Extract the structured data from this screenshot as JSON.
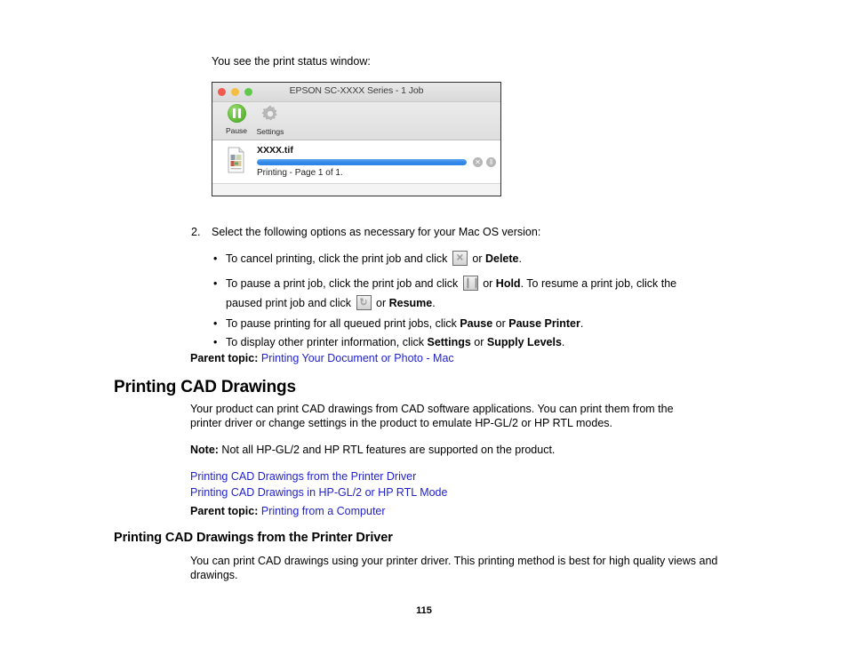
{
  "intro": {
    "text": "You see the print status window:"
  },
  "print_status_window": {
    "title": "EPSON SC-XXXX Series - 1 Job",
    "traffic_lights": {
      "close": "close-button",
      "minimize": "minimize-button",
      "zoom": "zoom-button"
    },
    "toolbar": {
      "pause_label": "Pause",
      "settings_label": "Settings"
    },
    "job": {
      "name": "XXXX.tif",
      "status": "Printing - Page 1 of 1.",
      "progress_percent": 100,
      "cancel_glyph": "✕",
      "hold_glyph": "‖"
    },
    "colors": {
      "close": "#f05a4f",
      "minimize": "#f5bd41",
      "zoom": "#60c94b",
      "pause_badge": "#60c94b",
      "progress": "#2f86e8"
    }
  },
  "step": {
    "number": "2.",
    "text": "Select the following options as necessary for your Mac OS version:",
    "bullet_mark": "•"
  },
  "bullets": {
    "cancel": {
      "part1": "To cancel printing, click the print job and click ",
      "icon": "cancel-x-icon",
      "part2": " or ",
      "bold": "Delete",
      "part3": "."
    },
    "pause": {
      "part1": "To pause a print job, click the print job and click ",
      "icon_hold": "hold-pause-icon",
      "part2": " or ",
      "bold1": "Hold",
      "part3": ". To resume a print job, click the",
      "line2_part1": "paused print job and click ",
      "icon_resume": "resume-icon",
      "line2_part2": " or ",
      "bold2": "Resume",
      "line2_part3": "."
    },
    "pause_all": {
      "part1": "To pause printing for all queued print jobs, click ",
      "bold1": "Pause",
      "part2": " or ",
      "bold2": "Pause Printer",
      "part3": "."
    },
    "display_info": {
      "part1": "To display other printer information, click ",
      "bold1": "Settings",
      "part2": " or ",
      "bold2": "Supply Levels",
      "part3": "."
    }
  },
  "parent_topic_1": {
    "label": "Parent topic:",
    "link": "Printing Your Document or Photo - Mac"
  },
  "section_cad": {
    "heading": "Printing CAD Drawings",
    "paragraph": "Your product can print CAD drawings from CAD software applications. You can print them from the printer driver or change settings in the product to emulate HP-GL/2 or HP RTL modes.",
    "note_label": "Note:",
    "note_text": " Not all HP-GL/2 and HP RTL features are supported on the product.",
    "links": [
      "Printing CAD Drawings from the Printer Driver",
      "Printing CAD Drawings in HP-GL/2 or HP RTL Mode"
    ],
    "parent_topic_label": "Parent topic:",
    "parent_topic_link": "Printing from a Computer"
  },
  "section_driver": {
    "heading": "Printing CAD Drawings from the Printer Driver",
    "paragraph": "You can print CAD drawings using your printer driver. This printing method is best for high quality views and drawings."
  },
  "footer": {
    "page_number": "115"
  },
  "theme": {
    "link_color": "#2222cc",
    "text_color": "#000000",
    "background": "#ffffff"
  }
}
